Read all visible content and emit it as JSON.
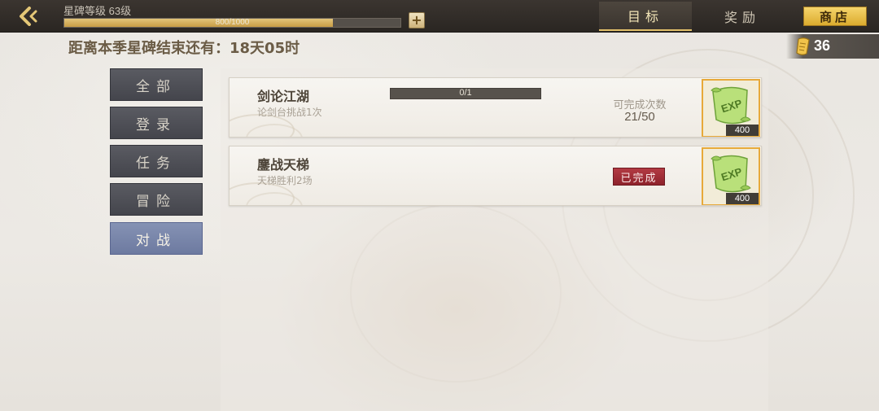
{
  "header": {
    "level_label": "星碑等级 63级",
    "xp_text": "800/1000",
    "xp_progress": 0.8,
    "tabs": [
      {
        "label": "目标",
        "active": true
      },
      {
        "label": "奖励",
        "active": false
      }
    ],
    "shop_label": "商店"
  },
  "countdown": "距离本季星碑结束还有：18天05时",
  "currency": {
    "icon": "scroll-icon",
    "value": "36"
  },
  "sidebar": {
    "items": [
      {
        "label": "全部",
        "active": false
      },
      {
        "label": "登录",
        "active": false
      },
      {
        "label": "任务",
        "active": false
      },
      {
        "label": "冒险",
        "active": false
      },
      {
        "label": "对战",
        "active": true
      }
    ]
  },
  "quests": [
    {
      "title": "剑论江湖",
      "desc": "论剑台挑战1次",
      "progress_text": "0/1",
      "progress": 0,
      "count_label": "可完成次数",
      "count_value": "21/50",
      "reward_icon": "exp-scroll-icon",
      "reward_count": "400"
    },
    {
      "title": "鏖战天梯",
      "desc": "天梯胜利2场",
      "status": "已完成",
      "reward_icon": "exp-scroll-icon",
      "reward_count": "400"
    }
  ],
  "colors": {
    "accent_gold": "#e2c06a",
    "active_side": "#7784aa",
    "done_red": "#a02f37"
  }
}
